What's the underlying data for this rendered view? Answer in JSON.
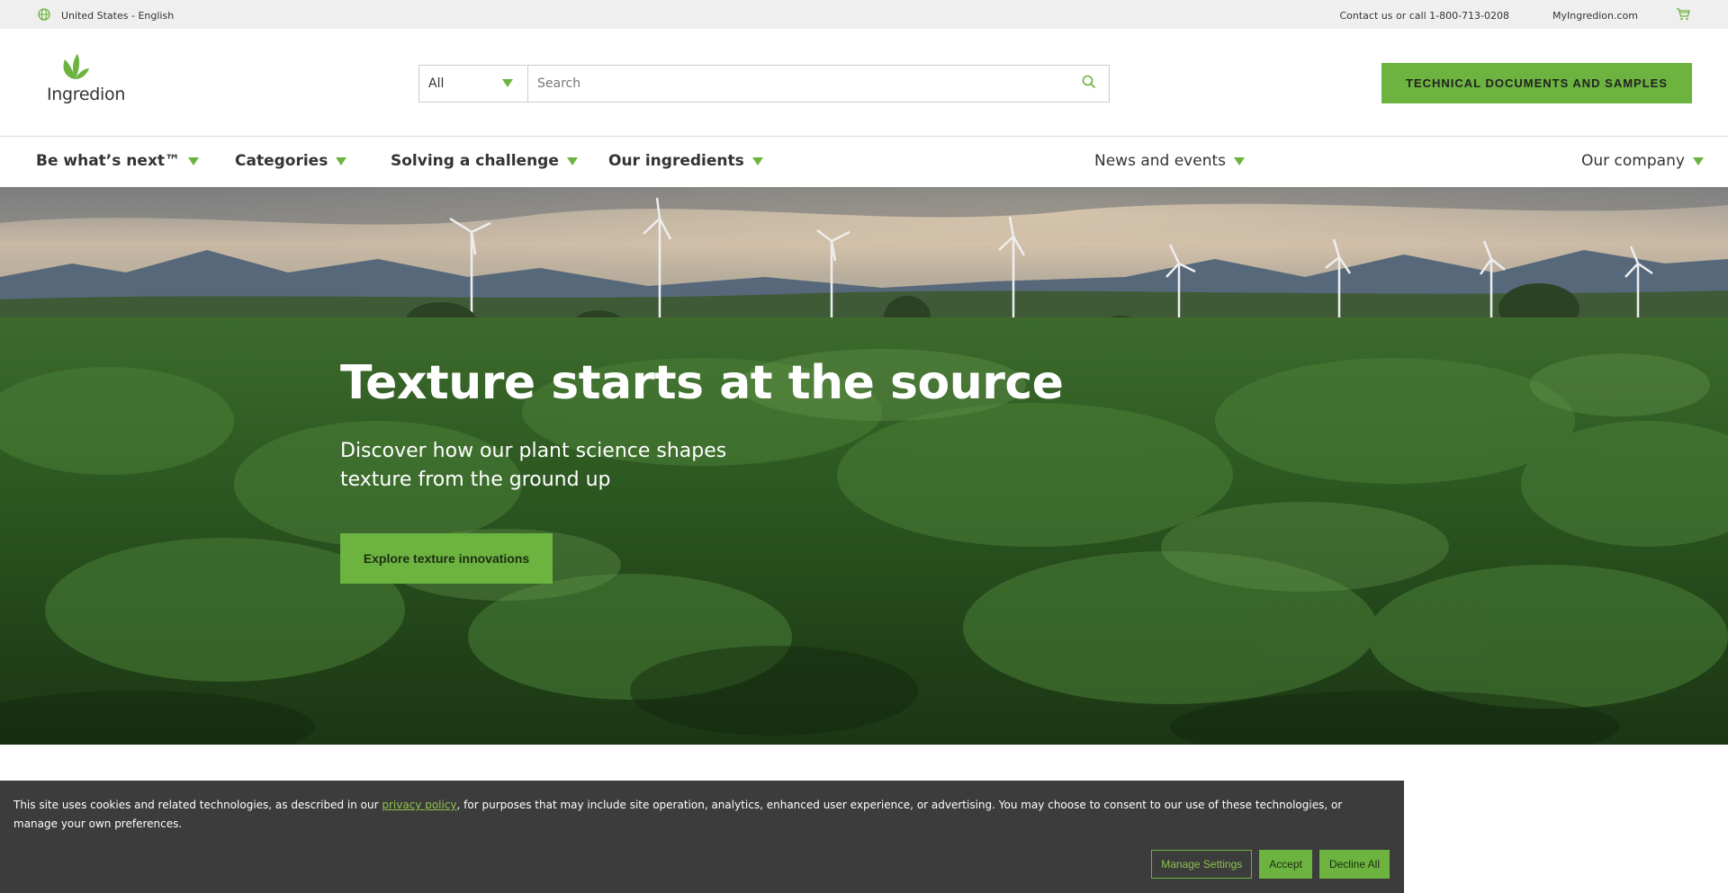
{
  "util_bar": {
    "locale": "United States - English",
    "contact": "Contact us or call 1-800-713-0208",
    "my_ingredion": "MyIngredion.com"
  },
  "header": {
    "logo_text": "Ingredion",
    "search": {
      "category": "All",
      "placeholder": "Search"
    },
    "tech_button": "TECHNICAL DOCUMENTS AND SAMPLES"
  },
  "nav": {
    "items": [
      {
        "label": "Be what’s next™"
      },
      {
        "label": "Categories"
      },
      {
        "label": "Solving a challenge"
      },
      {
        "label": "Our ingredients"
      },
      {
        "label": "News and events"
      },
      {
        "label": "Our company"
      }
    ]
  },
  "hero": {
    "title": "Texture starts at the source",
    "subtitle_line1": "Discover how our plant science shapes",
    "subtitle_line2": "texture from the ground up",
    "cta": "Explore texture innovations"
  },
  "cookie": {
    "text_before": "This site uses cookies and related technologies, as described in our ",
    "link": "privacy policy",
    "text_after": ", for purposes that may include site operation, analytics, enhanced user experience, or advertising. You may choose to consent to our use of these technologies, or manage your own preferences.",
    "manage": "Manage Settings",
    "accept": "Accept",
    "decline": "Decline All"
  },
  "colors": {
    "brand_green": "#6cb33f",
    "banner_bg": "#3c3c3c",
    "util_bg": "#efefef"
  },
  "icons": {
    "locale": "globe-icon",
    "cart": "cart-icon",
    "search": "search-icon",
    "logo": "leaf-logo-icon"
  }
}
